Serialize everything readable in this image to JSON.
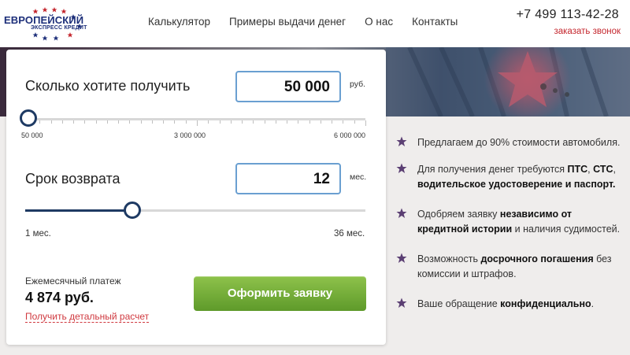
{
  "header": {
    "logo_main": "ЕВРОПЕЙСКИЙ",
    "logo_sub": "ЭКСПРЕСС КРЕДИТ",
    "nav": [
      "Калькулятор",
      "Примеры выдачи денег",
      "О нас",
      "Контакты"
    ],
    "phone": "+7 499 113-42-28",
    "callback": "заказать звонок"
  },
  "calculator": {
    "amount": {
      "label": "Сколько хотите получить",
      "value": "50 000",
      "unit": "руб.",
      "slider_fraction": 0.0,
      "min_label": "50 000",
      "mid_label": "3 000 000",
      "max_label": "6 000 000"
    },
    "term": {
      "label": "Срок возврата",
      "value": "12",
      "unit": "мес.",
      "slider_fraction": 0.314,
      "min_label": "1 мес.",
      "max_label": "36 мес."
    },
    "payment_label": "Ежемесячный платеж",
    "payment_value": "4 874 руб.",
    "detail_link": "Получить детальный расчет",
    "apply_button": "Оформить заявку"
  },
  "benefits": [
    {
      "parts": [
        {
          "t": "Предлагаем до 90% стоимости автомобиля.",
          "b": false
        }
      ]
    },
    {
      "parts": [
        {
          "t": "Для получения денег требуются ",
          "b": false
        },
        {
          "t": "ПТС",
          "b": true
        },
        {
          "t": ", ",
          "b": false
        },
        {
          "t": "СТС",
          "b": true
        },
        {
          "t": ", ",
          "b": false
        },
        {
          "t": "водительское удостоверение и паспорт.",
          "b": true
        }
      ]
    },
    {
      "parts": [
        {
          "t": "Одобряем заявку ",
          "b": false
        },
        {
          "t": "независимо от кредитной истории",
          "b": true
        },
        {
          "t": " и наличия судимостей.",
          "b": false
        }
      ]
    },
    {
      "parts": [
        {
          "t": "Возможность ",
          "b": false
        },
        {
          "t": "досрочного погашения",
          "b": true
        },
        {
          "t": " без комиссии и штрафов.",
          "b": false
        }
      ]
    },
    {
      "parts": [
        {
          "t": "Ваше обращение ",
          "b": false
        },
        {
          "t": "конфиденциально",
          "b": true
        },
        {
          "t": ".",
          "b": false
        }
      ]
    }
  ],
  "colors": {
    "accent_blue": "#1e3a63",
    "button_green": "#6fa935",
    "link_red": "#d0393f",
    "star_purple": "#5b3f73"
  }
}
